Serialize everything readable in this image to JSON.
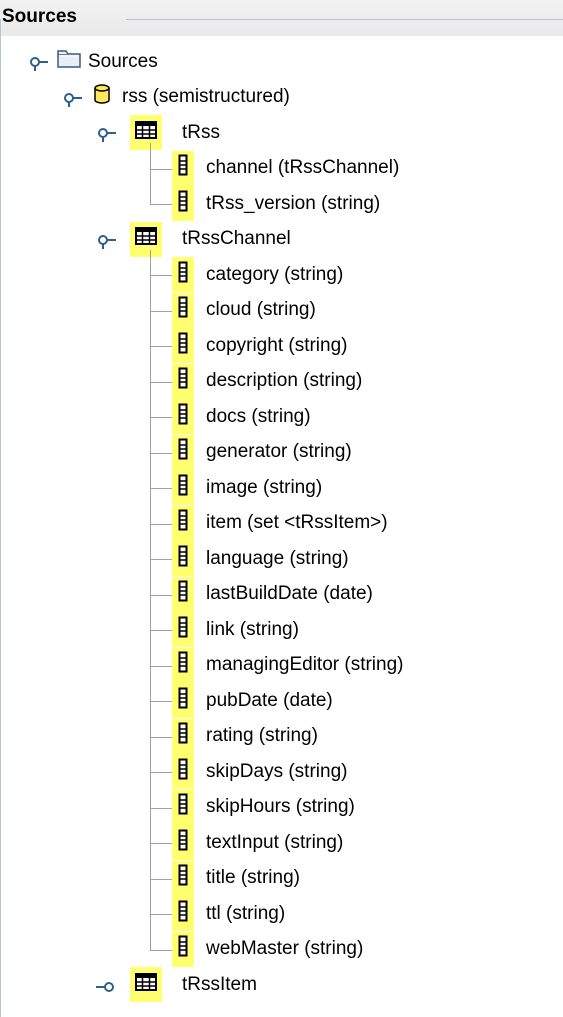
{
  "panel": {
    "title": "Sources"
  },
  "tree": {
    "root": {
      "label": "Sources",
      "icon": "folder-icon",
      "expanded": true
    },
    "database": {
      "label": "rss (semistructured)",
      "icon": "database-icon",
      "expanded": true
    },
    "tables": [
      {
        "label": "tRss",
        "icon": "table-icon",
        "expanded": true,
        "columns": [
          "channel (tRssChannel)",
          "tRss_version (string)"
        ]
      },
      {
        "label": "tRssChannel",
        "icon": "table-icon",
        "expanded": true,
        "columns": [
          "category (string)",
          "cloud (string)",
          "copyright (string)",
          "description (string)",
          "docs (string)",
          "generator (string)",
          "image (string)",
          "item (set <tRssItem>)",
          "language (string)",
          "lastBuildDate (date)",
          "link (string)",
          "managingEditor (string)",
          "pubDate (date)",
          "rating (string)",
          "skipDays (string)",
          "skipHours (string)",
          "textInput (string)",
          "title (string)",
          "ttl (string)",
          "webMaster (string)"
        ]
      },
      {
        "label": "tRssItem",
        "icon": "table-icon",
        "expanded": false,
        "columns": []
      }
    ]
  },
  "colors": {
    "highlight": "#ffff70",
    "border": "#b5c3d6",
    "tree_line": "#a0a0a0",
    "toggle": "#2f5f8f"
  }
}
